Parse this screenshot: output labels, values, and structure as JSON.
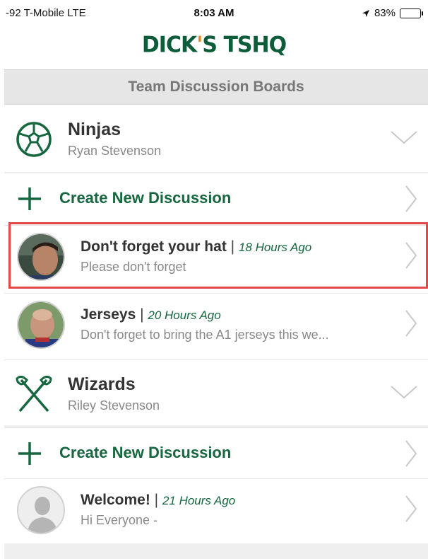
{
  "status_bar": {
    "carrier": "-92 T-Mobile  LTE",
    "time": "8:03 AM",
    "battery": "83%",
    "battery_level": 0.83
  },
  "app": {
    "logo_left": "DICK",
    "logo_apos": "'",
    "logo_right": "S TSHQ",
    "accent_color": "#16663f",
    "logo_color": "#0d5c3a"
  },
  "header": {
    "title": "Team Discussion Boards"
  },
  "teams": [
    {
      "name": "Ninjas",
      "coach": "Ryan Stevenson",
      "icon": "soccer-ball-icon",
      "create_label": "Create New Discussion",
      "discussions": [
        {
          "title": "Don't forget your hat",
          "separator": " | ",
          "ago": "18 Hours Ago",
          "preview": "Please don't forget",
          "avatar": "photo-avatar",
          "highlighted": true
        },
        {
          "title": "Jerseys",
          "separator": " | ",
          "ago": "20 Hours Ago",
          "preview": "Don't forget to bring the A1 jerseys this we...",
          "avatar": "photo-avatar",
          "highlighted": false
        }
      ]
    },
    {
      "name": "Wizards",
      "coach": "Riley Stevenson",
      "icon": "lacrosse-sticks-icon",
      "create_label": "Create New Discussion",
      "discussions": [
        {
          "title": "Welcome!",
          "separator": " | ",
          "ago": "21 Hours Ago",
          "preview": "Hi Everyone -",
          "avatar": "default-person-avatar",
          "highlighted": false
        }
      ]
    }
  ],
  "highlight_color": "#e0484a"
}
